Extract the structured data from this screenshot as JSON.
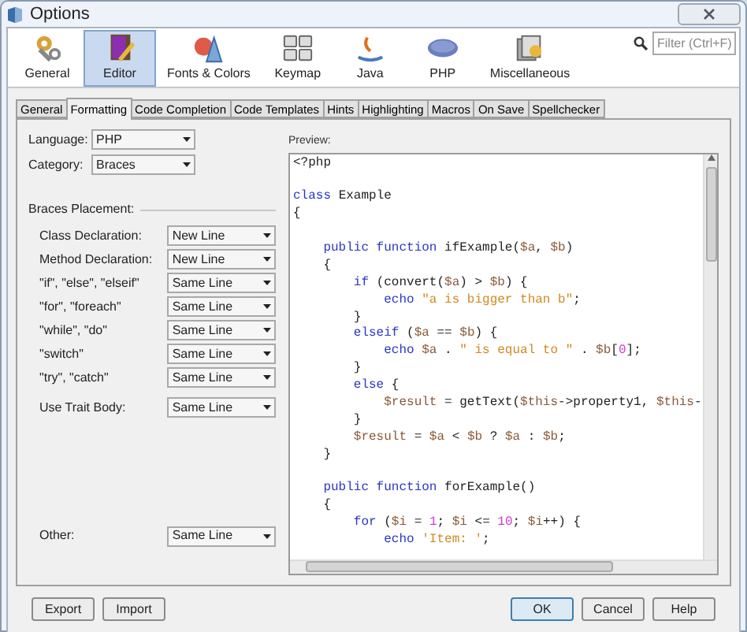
{
  "window": {
    "title": "Options"
  },
  "categories": [
    {
      "label": "General",
      "selected": false,
      "kind": "general"
    },
    {
      "label": "Editor",
      "selected": true,
      "kind": "editor"
    },
    {
      "label": "Fonts & Colors",
      "selected": false,
      "kind": "fonts"
    },
    {
      "label": "Keymap",
      "selected": false,
      "kind": "keymap"
    },
    {
      "label": "Java",
      "selected": false,
      "kind": "java"
    },
    {
      "label": "PHP",
      "selected": false,
      "kind": "php"
    },
    {
      "label": "Miscellaneous",
      "selected": false,
      "kind": "misc"
    }
  ],
  "filter": {
    "placeholder": "Filter (Ctrl+F)"
  },
  "tabs": [
    {
      "label": "General",
      "selected": false
    },
    {
      "label": "Formatting",
      "selected": true
    },
    {
      "label": "Code Completion",
      "selected": false
    },
    {
      "label": "Code Templates",
      "selected": false
    },
    {
      "label": "Hints",
      "selected": false
    },
    {
      "label": "Highlighting",
      "selected": false
    },
    {
      "label": "Macros",
      "selected": false
    },
    {
      "label": "On Save",
      "selected": false
    },
    {
      "label": "Spellchecker",
      "selected": false
    }
  ],
  "language": {
    "label": "Language:",
    "value": "PHP"
  },
  "category": {
    "label": "Category:",
    "value": "Braces"
  },
  "braces_placement": {
    "title": "Braces Placement:",
    "rows": [
      {
        "label": "Class Declaration:",
        "value": "New Line"
      },
      {
        "label": "Method Declaration:",
        "value": "New Line"
      },
      {
        "label": "\"if\", \"else\", \"elseif\"",
        "value": "Same Line"
      },
      {
        "label": "\"for\", \"foreach\"",
        "value": "Same Line"
      },
      {
        "label": "\"while\", \"do\"",
        "value": "Same Line"
      },
      {
        "label": "\"switch\"",
        "value": "Same Line"
      },
      {
        "label": "\"try\", \"catch\"",
        "value": "Same Line"
      }
    ],
    "trait": {
      "label": "Use Trait Body:",
      "value": "Same Line"
    }
  },
  "other": {
    "label": "Other:",
    "value": "Same Line"
  },
  "preview": {
    "label": "Preview:",
    "lines": [
      {
        "kind": "code",
        "tokens": [
          {
            "text": "<?php",
            "kind": "plain"
          }
        ]
      },
      {
        "kind": "blank"
      },
      {
        "kind": "code",
        "tokens": [
          {
            "text": "class",
            "kind": "keyword"
          },
          {
            "text": " Example",
            "kind": "plain"
          }
        ]
      },
      {
        "kind": "code",
        "tokens": [
          {
            "text": "{",
            "kind": "plain"
          }
        ]
      },
      {
        "kind": "blank"
      },
      {
        "kind": "code",
        "tokens": [
          {
            "text": "    public function",
            "kind": "keyword"
          },
          {
            "text": " ifExample(",
            "kind": "plain"
          },
          {
            "text": "$a",
            "kind": "variable"
          },
          {
            "text": ", ",
            "kind": "plain"
          },
          {
            "text": "$b",
            "kind": "variable"
          },
          {
            "text": ")",
            "kind": "plain"
          }
        ]
      },
      {
        "kind": "code",
        "tokens": [
          {
            "text": "    {",
            "kind": "plain"
          }
        ]
      },
      {
        "kind": "code",
        "tokens": [
          {
            "text": "        if",
            "kind": "keyword"
          },
          {
            "text": " (convert(",
            "kind": "plain"
          },
          {
            "text": "$a",
            "kind": "variable"
          },
          {
            "text": ") > ",
            "kind": "plain"
          },
          {
            "text": "$b",
            "kind": "variable"
          },
          {
            "text": ") {",
            "kind": "plain"
          }
        ]
      },
      {
        "kind": "code",
        "tokens": [
          {
            "text": "            echo",
            "kind": "keyword"
          },
          {
            "text": " \"a is bigger than b\"",
            "kind": "string"
          },
          {
            "text": ";",
            "kind": "plain"
          }
        ]
      },
      {
        "kind": "code",
        "tokens": [
          {
            "text": "        }",
            "kind": "plain"
          }
        ]
      },
      {
        "kind": "code",
        "tokens": [
          {
            "text": "        elseif",
            "kind": "keyword"
          },
          {
            "text": " (",
            "kind": "plain"
          },
          {
            "text": "$a",
            "kind": "variable"
          },
          {
            "text": " == ",
            "kind": "plain"
          },
          {
            "text": "$b",
            "kind": "variable"
          },
          {
            "text": ") {",
            "kind": "plain"
          }
        ]
      },
      {
        "kind": "code",
        "tokens": [
          {
            "text": "            echo",
            "kind": "keyword"
          },
          {
            "text": " $a",
            "kind": "variable"
          },
          {
            "text": " . ",
            "kind": "plain"
          },
          {
            "text": "\" is equal to \"",
            "kind": "string"
          },
          {
            "text": " . ",
            "kind": "plain"
          },
          {
            "text": "$b",
            "kind": "variable"
          },
          {
            "text": "[",
            "kind": "plain"
          },
          {
            "text": "0",
            "kind": "number"
          },
          {
            "text": "];",
            "kind": "plain"
          }
        ]
      },
      {
        "kind": "code",
        "tokens": [
          {
            "text": "        }",
            "kind": "plain"
          }
        ]
      },
      {
        "kind": "code",
        "tokens": [
          {
            "text": "        else",
            "kind": "keyword"
          },
          {
            "text": " {",
            "kind": "plain"
          }
        ]
      },
      {
        "kind": "code",
        "tokens": [
          {
            "text": "            $result",
            "kind": "variable"
          },
          {
            "text": " = getText(",
            "kind": "plain"
          },
          {
            "text": "$this",
            "kind": "variable"
          },
          {
            "text": "->property1, ",
            "kind": "plain"
          },
          {
            "text": "$this",
            "kind": "variable"
          },
          {
            "text": "-",
            "kind": "plain"
          }
        ]
      },
      {
        "kind": "code",
        "tokens": [
          {
            "text": "        }",
            "kind": "plain"
          }
        ]
      },
      {
        "kind": "code",
        "tokens": [
          {
            "text": "        $result",
            "kind": "variable"
          },
          {
            "text": " = ",
            "kind": "plain"
          },
          {
            "text": "$a",
            "kind": "variable"
          },
          {
            "text": " < ",
            "kind": "plain"
          },
          {
            "text": "$b",
            "kind": "variable"
          },
          {
            "text": " ? ",
            "kind": "plain"
          },
          {
            "text": "$a",
            "kind": "variable"
          },
          {
            "text": " : ",
            "kind": "plain"
          },
          {
            "text": "$b",
            "kind": "variable"
          },
          {
            "text": ";",
            "kind": "plain"
          }
        ]
      },
      {
        "kind": "code",
        "tokens": [
          {
            "text": "    }",
            "kind": "plain"
          }
        ]
      },
      {
        "kind": "blank"
      },
      {
        "kind": "code",
        "tokens": [
          {
            "text": "    public function",
            "kind": "keyword"
          },
          {
            "text": " forExample()",
            "kind": "plain"
          }
        ]
      },
      {
        "kind": "code",
        "tokens": [
          {
            "text": "    {",
            "kind": "plain"
          }
        ]
      },
      {
        "kind": "code",
        "tokens": [
          {
            "text": "        for",
            "kind": "keyword"
          },
          {
            "text": " (",
            "kind": "plain"
          },
          {
            "text": "$i",
            "kind": "variable"
          },
          {
            "text": " = ",
            "kind": "plain"
          },
          {
            "text": "1",
            "kind": "number"
          },
          {
            "text": "; ",
            "kind": "plain"
          },
          {
            "text": "$i",
            "kind": "variable"
          },
          {
            "text": " <= ",
            "kind": "plain"
          },
          {
            "text": "10",
            "kind": "number"
          },
          {
            "text": "; ",
            "kind": "plain"
          },
          {
            "text": "$i",
            "kind": "variable"
          },
          {
            "text": "++) {",
            "kind": "plain"
          }
        ]
      },
      {
        "kind": "code",
        "tokens": [
          {
            "text": "            echo",
            "kind": "keyword"
          },
          {
            "text": " 'Item: '",
            "kind": "string"
          },
          {
            "text": ";",
            "kind": "plain"
          }
        ]
      }
    ]
  },
  "buttons_left": [
    "Export",
    "Import"
  ],
  "buttons_right": [
    {
      "label": "OK",
      "kind": "default"
    },
    {
      "label": "Cancel",
      "kind": "normal"
    },
    {
      "label": "Help",
      "kind": "normal"
    }
  ]
}
